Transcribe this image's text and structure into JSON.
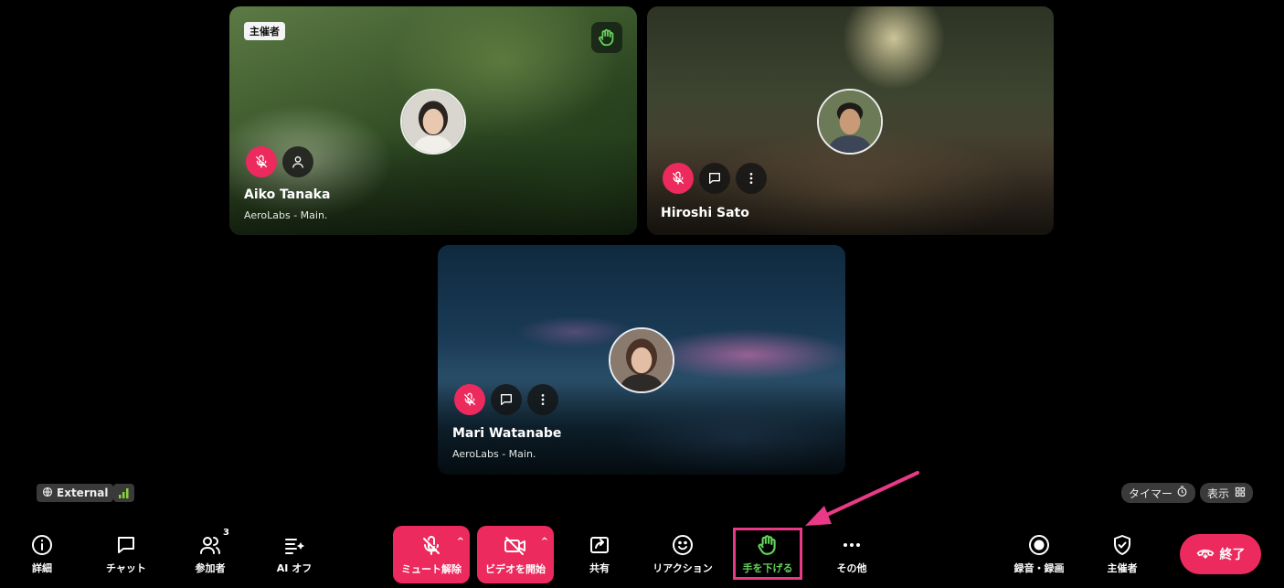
{
  "participants": [
    {
      "name": "Aiko Tanaka",
      "subtitle": "AeroLabs - Main.",
      "host_label": "主催者"
    },
    {
      "name": "Hiroshi Sato"
    },
    {
      "name": "Mari Watanabe",
      "subtitle": "AeroLabs - Main."
    }
  ],
  "status": {
    "external_label": "External",
    "timer_label": "タイマー",
    "view_label": "表示"
  },
  "toolbar": {
    "details": "詳細",
    "chat": "チャット",
    "participants": "参加者",
    "participant_count": "3",
    "ai_off": "AI オフ",
    "unmute": "ミュート解除",
    "start_video": "ビデオを開始",
    "share": "共有",
    "reactions": "リアクション",
    "lower_hand": "手を下げる",
    "more": "その他",
    "record": "録音・録画",
    "host": "主催者",
    "end": "終了"
  },
  "colors": {
    "accent_red": "#ec2a5e",
    "hand_green": "#63d05a",
    "highlight_pink": "#e83a86",
    "signal_green": "#8ad23a"
  },
  "icons": [
    "info-icon",
    "chat-icon",
    "participants-icon",
    "ai-icon",
    "mic-off-icon",
    "video-off-icon",
    "share-icon",
    "reaction-icon",
    "hand-icon",
    "more-icon",
    "record-icon",
    "shield-icon",
    "phone-end-icon",
    "person-icon",
    "kebab-icon",
    "timer-icon",
    "grid-icon",
    "globe-icon",
    "signal-icon"
  ]
}
